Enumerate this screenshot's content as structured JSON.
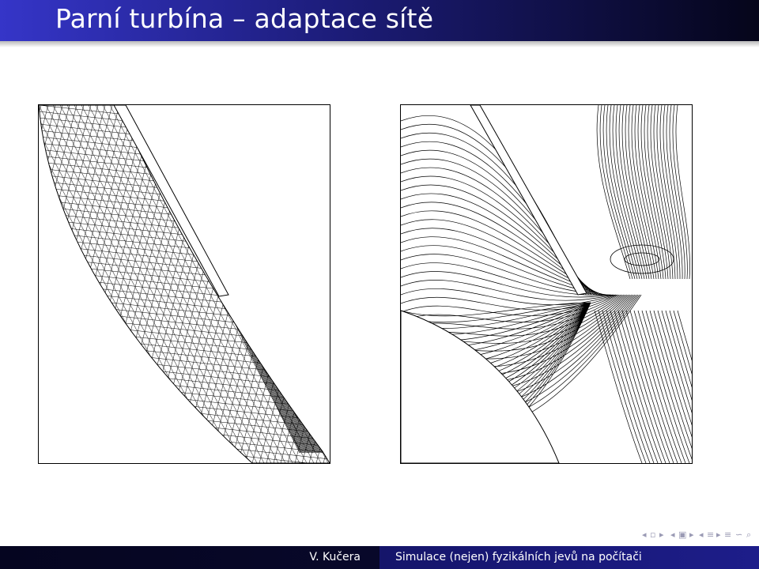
{
  "slide": {
    "title": "Parní turbína – adaptace sítě"
  },
  "figures": {
    "left": "mesh",
    "right": "contours"
  },
  "navigation": {
    "icons": [
      "triangle-left-icon",
      "frame-icon",
      "triangle-right-icon",
      "triangle-left-icon",
      "subsection-icon",
      "triangle-right-icon",
      "triangle-left-icon",
      "section-icon",
      "triangle-right-icon",
      "triangle-left-icon",
      "presentation-icon",
      "triangle-right-icon",
      "align-icon",
      "search-icon"
    ]
  },
  "footer": {
    "author": "V. Kučera",
    "talk_title": "Simulace (nejen) fyzikálních jevů na počítači"
  },
  "colors": {
    "header_left": "#3535c8",
    "header_right": "#05051a",
    "footer_left": "#050520",
    "footer_right": "#1d1d8a"
  }
}
